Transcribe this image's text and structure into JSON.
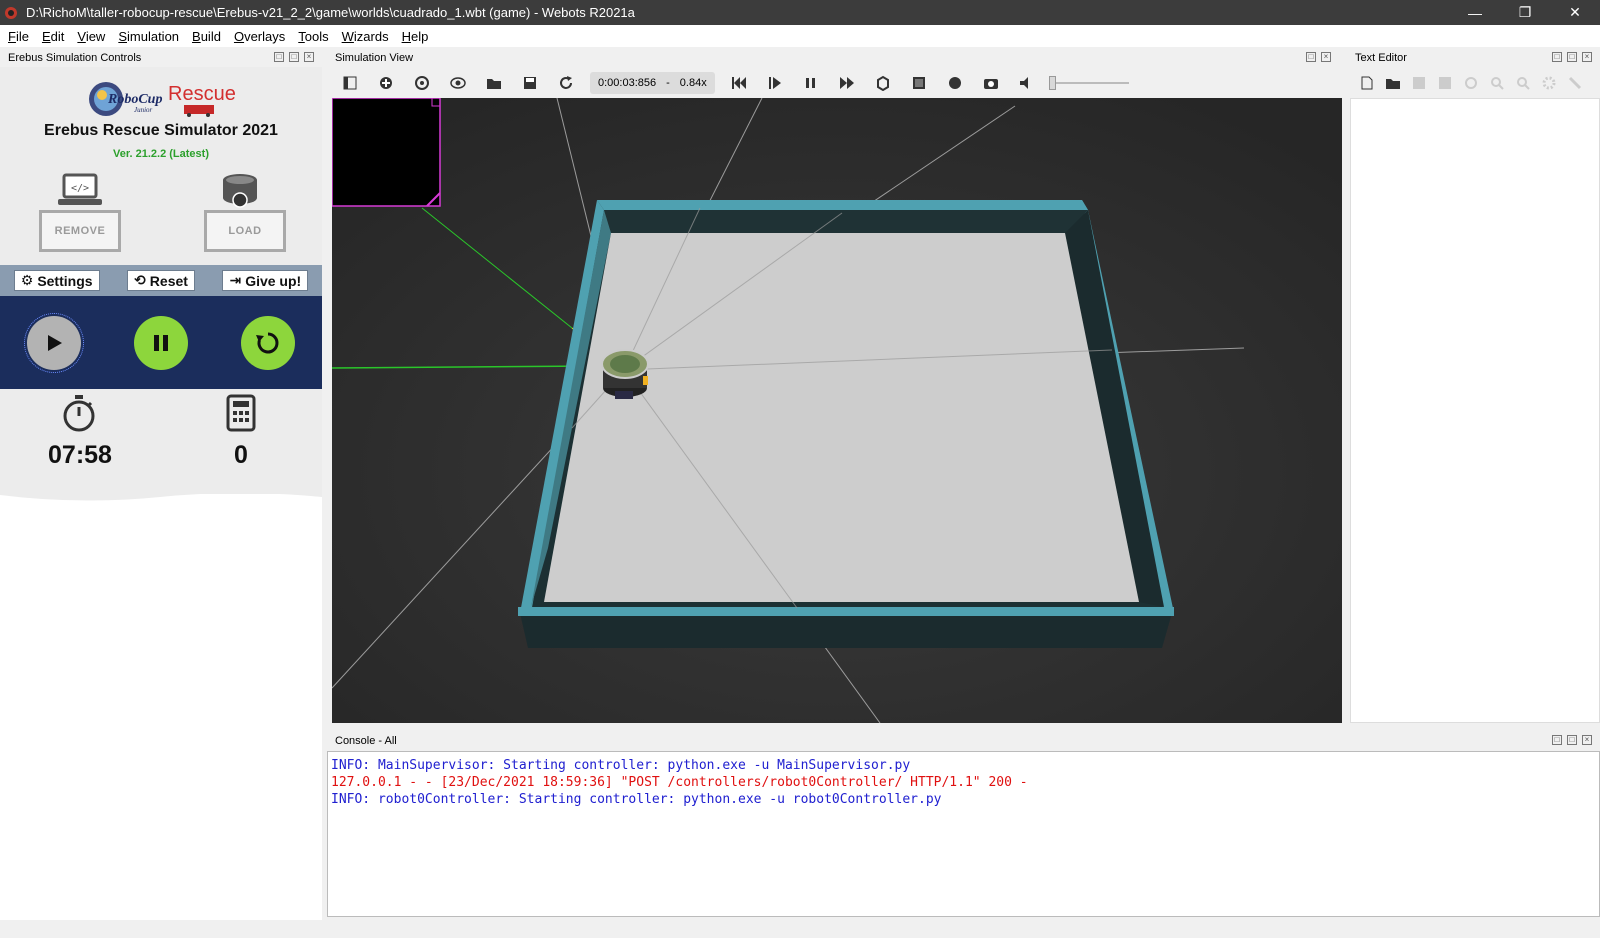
{
  "window": {
    "title": "D:\\RichoM\\taller-robocup-rescue\\Erebus-v21_2_2\\game\\worlds\\cuadrado_1.wbt (game) - Webots R2021a",
    "controls": [
      "—",
      "❐",
      "✕"
    ]
  },
  "menu": [
    {
      "first": "F",
      "rest": "ile"
    },
    {
      "first": "E",
      "rest": "dit"
    },
    {
      "first": "V",
      "rest": "iew"
    },
    {
      "first": "S",
      "rest": "imulation"
    },
    {
      "first": "B",
      "rest": "uild"
    },
    {
      "first": "O",
      "rest": "verlays"
    },
    {
      "first": "T",
      "rest": "ools"
    },
    {
      "first": "W",
      "rest": "izards"
    },
    {
      "first": "H",
      "rest": "elp"
    }
  ],
  "docks": {
    "controls_title": "Erebus Simulation Controls",
    "sim_view_title": "Simulation View",
    "editor_title": "Text Editor",
    "console_title": "Console - All"
  },
  "erebus": {
    "logo_robocup": "RoboCup",
    "logo_junior": "Junior",
    "logo_rescue": "Rescue",
    "title": "Erebus Rescue Simulator 2021",
    "version": "Ver. 21.2.2 (Latest)",
    "remove_label": "REMOVE",
    "load_label": "LOAD",
    "settings_label": "Settings",
    "reset_label": "Reset",
    "giveup_label": "Give up!",
    "timer": "07:58",
    "score": "0",
    "colors": {
      "play": "#b3b3b3",
      "pause": "#8dd63c",
      "restart": "#8dd63c",
      "nav": "#1b2d5c"
    }
  },
  "sim": {
    "time": "0:00:03:856",
    "separator": "-",
    "speed": "0.84x"
  },
  "console": [
    {
      "text": "INFO: MainSupervisor: Starting controller: python.exe -u MainSupervisor.py",
      "color": "#2020d0"
    },
    {
      "text": "127.0.0.1 - - [23/Dec/2021 18:59:36] \"POST /controllers/robot0Controller/ HTTP/1.1\" 200 -",
      "color": "#e01010"
    },
    {
      "text": "INFO: robot0Controller: Starting controller: python.exe -u robot0Controller.py",
      "color": "#2020d0"
    }
  ]
}
